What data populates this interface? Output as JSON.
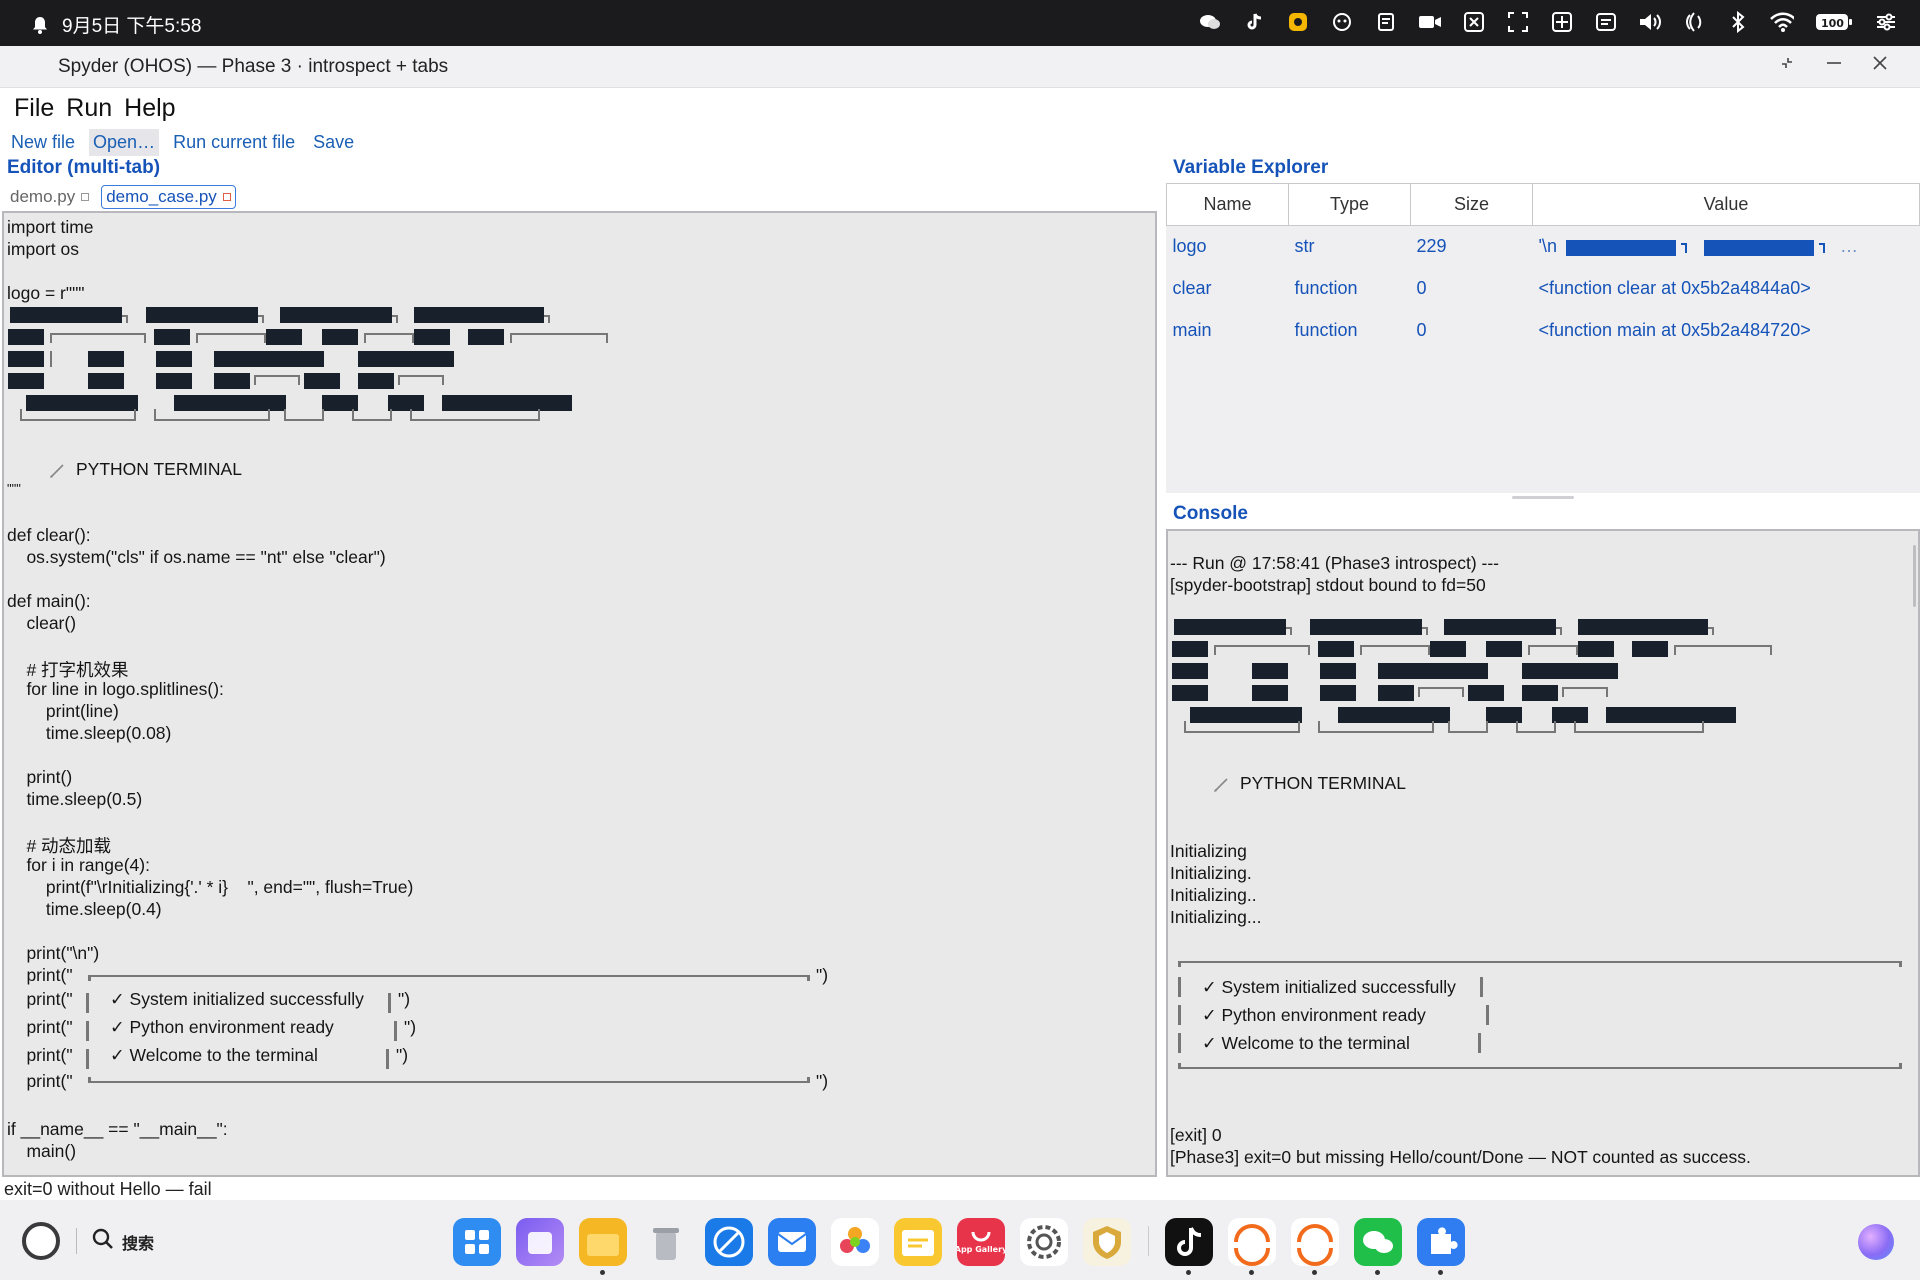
{
  "status_bar": {
    "datetime": "9月5日 下午5:58",
    "battery": "100"
  },
  "window": {
    "title": "Spyder (OHOS) — Phase 3 · introspect + tabs"
  },
  "menu": [
    "File",
    "Run",
    "Help"
  ],
  "toolbar": {
    "new_file": "New file",
    "open": "Open…",
    "run_current": "Run current file",
    "save": "Save"
  },
  "editor": {
    "title": "Editor (multi-tab)",
    "tabs": [
      {
        "label": "demo.py",
        "active": false
      },
      {
        "label": "demo_case.py",
        "active": true
      }
    ],
    "lines": {
      "l1": "import time",
      "l2": "import os",
      "l3": "logo = r\"\"\"",
      "l4": "PYTHON TERMINAL",
      "l5": "\"\"\"",
      "l6": "def clear():",
      "l7": "    os.system(\"cls\" if os.name == \"nt\" else \"clear\")",
      "l8": "def main():",
      "l9": "    clear()",
      "l10": "    # 打字机效果",
      "l11": "    for line in logo.splitlines():",
      "l12": "        print(line)",
      "l13": "        time.sleep(0.08)",
      "l14": "    print()",
      "l15": "    time.sleep(0.5)",
      "l16": "    # 动态加载",
      "l17": "    for i in range(4):",
      "l18": "        print(f\"\\rInitializing{'.' * i}    \", end=\"\", flush=True)",
      "l19": "        time.sleep(0.4)",
      "l20": "    print(\"\\n\")",
      "l21": "    print(\"",
      "l22": "    print(\"",
      "l23": "    print(\"",
      "l24": "    print(\"",
      "l25": "    print(\"",
      "l26": "if __name__ == \"__main__\":",
      "l27": "    main()",
      "box_end": "\")",
      "box1": "✓ System initialized successfully",
      "box2": "✓ Python environment ready",
      "box3": "✓ Welcome to the terminal"
    }
  },
  "variable_explorer": {
    "title": "Variable Explorer",
    "columns": [
      "Name",
      "Type",
      "Size",
      "Value"
    ],
    "rows": [
      {
        "name": "logo",
        "type": "str",
        "size": "229",
        "value_prefix": "'\\n",
        "value_suffix": "…"
      },
      {
        "name": "clear",
        "type": "function",
        "size": "0",
        "value": "<function clear at 0x5b2a4844a0>"
      },
      {
        "name": "main",
        "type": "function",
        "size": "0",
        "value": "<function main at 0x5b2a484720>"
      }
    ]
  },
  "console": {
    "title": "Console",
    "lines": {
      "run": "--- Run @ 17:58:41 (Phase3 introspect) ---",
      "bootstrap": "[spyder-bootstrap] stdout bound to fd=50",
      "banner": "PYTHON TERMINAL",
      "init0": "Initializing",
      "init1": "Initializing.",
      "init2": "Initializing..",
      "init3": "Initializing...",
      "box1": "✓ System initialized successfully",
      "box2": "✓ Python environment ready",
      "box3": "✓ Welcome to the terminal",
      "exit": "[exit] 0",
      "verdict": "[Phase3] exit=0 but missing Hello/count/Done — NOT counted as success."
    }
  },
  "status_line": "exit=0 without Hello — fail",
  "taskbar": {
    "search_label": "搜索",
    "apps": [
      "app-grid",
      "multitask",
      "files",
      "trash",
      "browser",
      "mail",
      "gallery",
      "notes",
      "app-gallery",
      "settings",
      "security",
      "tiktok",
      "app-orange-1",
      "app-orange-2",
      "wechat",
      "puzzle"
    ],
    "app_gallery_label": "App Gallery"
  }
}
